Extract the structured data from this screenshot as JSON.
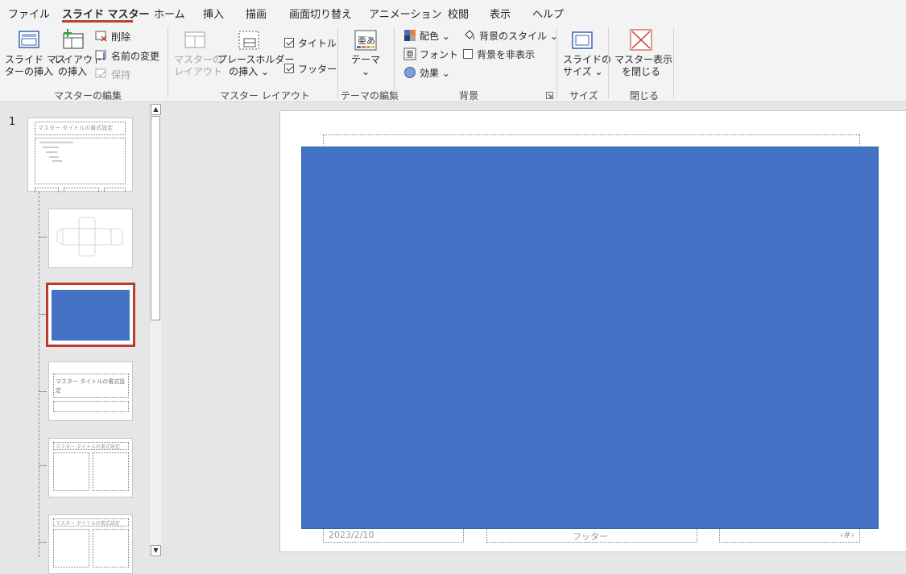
{
  "tabs": [
    "ファイル",
    "スライド マスター",
    "ホーム",
    "挿入",
    "描画",
    "画面切り替え",
    "アニメーション",
    "校閲",
    "表示",
    "ヘルプ"
  ],
  "ribbon": {
    "groups": {
      "master_edit": "マスターの編集",
      "master_layout": "マスター レイアウト",
      "theme_edit": "テーマの編集",
      "background": "背景",
      "size": "サイズ",
      "close": "閉じる"
    },
    "insert_slide_master": [
      "スライド マス",
      "ターの挿入"
    ],
    "insert_layout": [
      "レイアウト",
      "の挿入"
    ],
    "delete": "削除",
    "rename": "名前の変更",
    "preserve": "保持",
    "master_layout_btn": [
      "マスターの",
      "レイアウト"
    ],
    "insert_placeholder": [
      "プレースホルダー",
      "の挿入 ⌄"
    ],
    "title_check": "タイトル",
    "footer_check": "フッター",
    "theme": [
      "テーマ",
      "⌄"
    ],
    "colors": "配色 ⌄",
    "fonts": "フォント ⌄",
    "effects": "効果 ⌄",
    "bg_styles": "背景のスタイル ⌄",
    "hide_bg": "背景を非表示",
    "slide_size": [
      "スライドの",
      "サイズ ⌄"
    ],
    "close_master": [
      "マスター表示",
      "を閉じる"
    ]
  },
  "panel": {
    "slide_number": "1",
    "thumb_title": "マスター タイトルの書式設定",
    "thumb4_title": "マスター タイトルの書式設定"
  },
  "slide": {
    "footer_date": "2023/2/10",
    "footer_text": "フッター",
    "footer_num": "‹#›"
  },
  "colors": {
    "accent": "#b7472a",
    "selection": "#c0392b",
    "blue_shape": "#4472c4"
  }
}
